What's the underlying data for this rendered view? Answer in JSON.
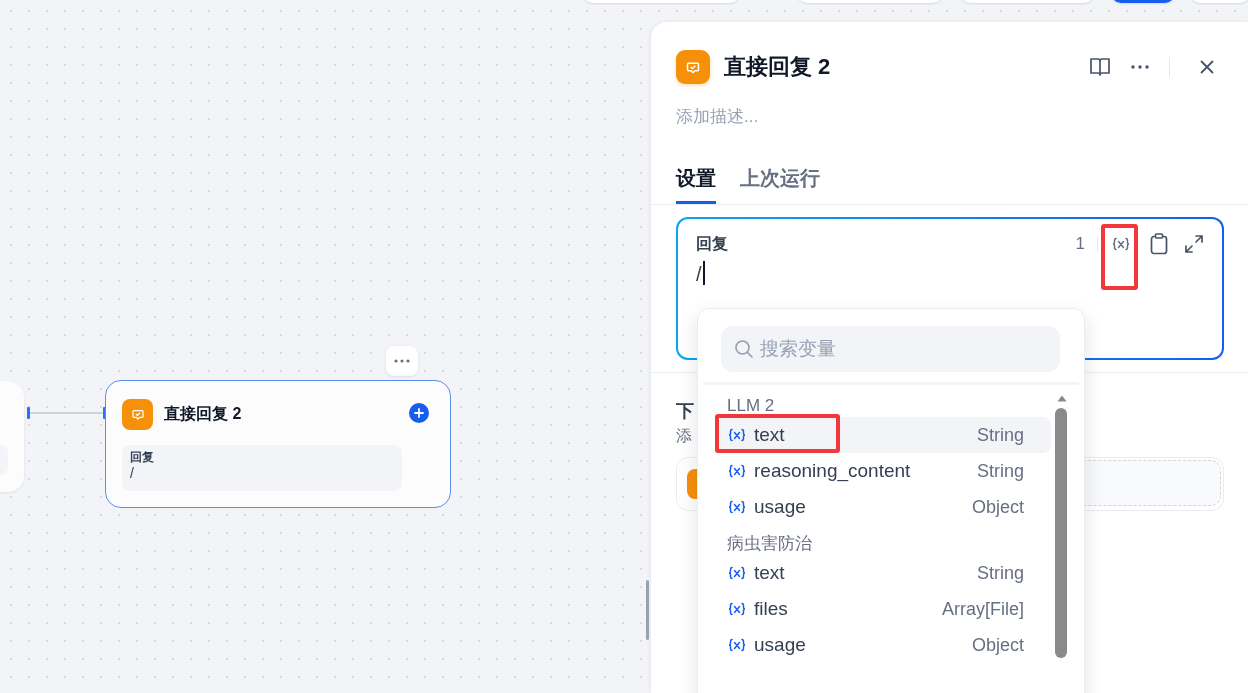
{
  "top_toolbar": [
    {
      "kind": "default"
    },
    {
      "kind": "default"
    },
    {
      "kind": "default"
    },
    {
      "kind": "primary"
    },
    {
      "kind": "default"
    }
  ],
  "canvas": {
    "nodes": [
      {
        "title": "直接回复 2",
        "selected": true,
        "fields": [
          {
            "label": "回复",
            "value": "/"
          }
        ]
      }
    ]
  },
  "panel": {
    "title": "直接回复 2",
    "description_placeholder": "添加描述...",
    "tabs": [
      {
        "label": "设置",
        "selected": true
      },
      {
        "label": "上次运行",
        "selected": false
      }
    ],
    "editor": {
      "label": "回复",
      "count": "1",
      "value": "/",
      "variable_button_highlighted": true
    },
    "next_step": {
      "heading": "下",
      "description": "添"
    }
  },
  "variable_menu": {
    "placeholder": "搜索变量",
    "groups": [
      {
        "name": "LLM 2",
        "items": [
          {
            "name": "text",
            "type": "String",
            "selected": true,
            "highlighted": true
          },
          {
            "name": "reasoning_content",
            "type": "String",
            "selected": false,
            "highlighted": false
          },
          {
            "name": "usage",
            "type": "Object",
            "selected": false,
            "highlighted": false
          }
        ]
      },
      {
        "name": "病虫害防治",
        "items": [
          {
            "name": "text",
            "type": "String",
            "selected": false,
            "highlighted": false
          },
          {
            "name": "files",
            "type": "Array[File]",
            "selected": false,
            "highlighted": false
          },
          {
            "name": "usage",
            "type": "Object",
            "selected": false,
            "highlighted": false
          }
        ]
      }
    ]
  }
}
